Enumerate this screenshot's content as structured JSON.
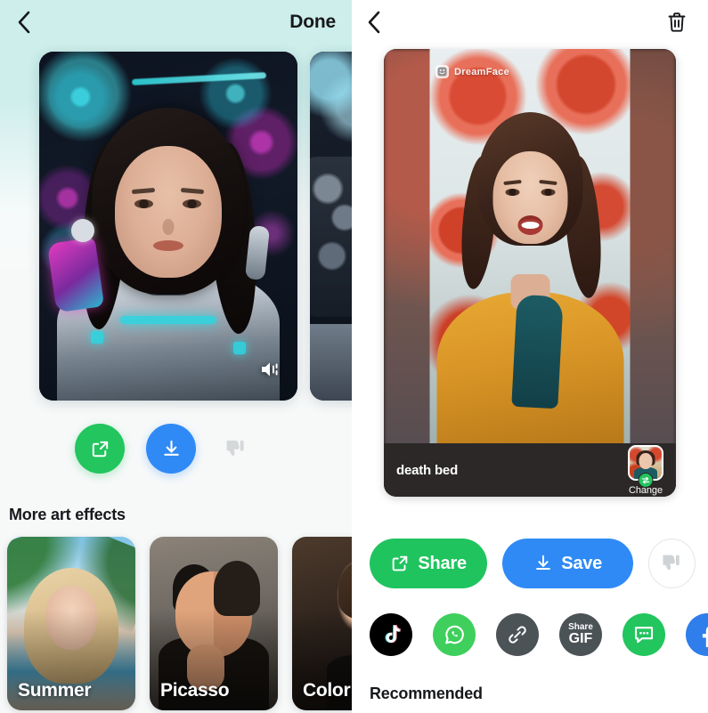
{
  "left_panel": {
    "header": {
      "back_icon": "chevron-left-icon",
      "done_label": "Done"
    },
    "preview": {
      "volume_icon": "volume-icon",
      "slides": [
        {
          "alt": "cyberpunk-portrait-result"
        },
        {
          "alt": "cyberpunk-portrait-result-next"
        }
      ]
    },
    "actions": [
      {
        "name": "share",
        "icon": "share-external-icon",
        "color": "#22c55e"
      },
      {
        "name": "download",
        "icon": "download-icon",
        "color": "#2f8af5"
      },
      {
        "name": "dislike",
        "icon": "thumbs-down-icon",
        "color": "#d5d8da"
      }
    ],
    "more_effects": {
      "title": "More art effects",
      "items": [
        {
          "label": "Summer"
        },
        {
          "label": "Picasso"
        },
        {
          "label": "Color"
        }
      ]
    }
  },
  "right_panel": {
    "header": {
      "back_icon": "chevron-left-icon",
      "delete_icon": "trash-icon"
    },
    "media_card": {
      "watermark": "DreamFace",
      "title": "death bed",
      "change_label": "Change",
      "change_badge_icon": "swap-icon"
    },
    "primary_actions": {
      "share_label": "Share",
      "share_icon": "share-external-icon",
      "share_color": "#1fc45f",
      "save_label": "Save",
      "save_icon": "download-icon",
      "save_color": "#2f8af5",
      "dislike_icon": "thumbs-down-icon"
    },
    "social": [
      {
        "name": "tiktok",
        "label": "",
        "color": "#000000"
      },
      {
        "name": "whatsapp",
        "label": "",
        "color": "#3fcf5c"
      },
      {
        "name": "link",
        "label": "",
        "color": "#4c5357"
      },
      {
        "name": "gif",
        "label_top": "Share",
        "label_bottom": "GIF",
        "color": "#4c5357"
      },
      {
        "name": "message",
        "label": "",
        "color": "#22c55e"
      },
      {
        "name": "facebook",
        "label": "",
        "color": "#2f7eeb"
      }
    ],
    "recommended_title": "Recommended"
  }
}
